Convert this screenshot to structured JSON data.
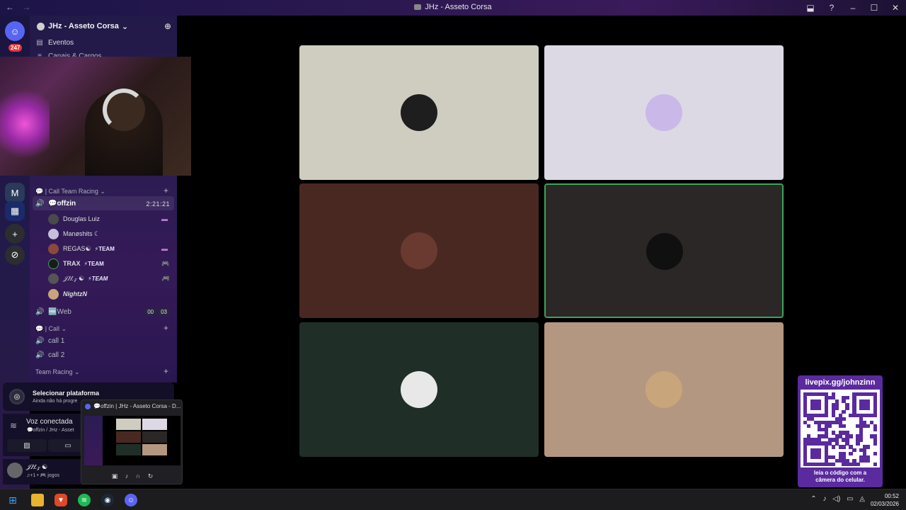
{
  "window": {
    "title": "JHz - Asseto Corsa",
    "nav_back": "←",
    "nav_forward": "→",
    "controls": [
      "⬓",
      "?",
      "–",
      "☐",
      "✕"
    ]
  },
  "servers": {
    "home_badge": "247"
  },
  "guild": {
    "name": "JHz - Asseto Corsa",
    "chevron": "⌄",
    "add_icon": "⊕"
  },
  "channels": {
    "events": "Eventos",
    "channels_roles": "Canais & Cargos",
    "category_call_team": "💬 | Call Team Racing ⌄",
    "active_channel": "💬offzin",
    "active_timer": "2:21:21",
    "members": [
      {
        "name": "Douglas Luiz",
        "team": "",
        "status": "▬"
      },
      {
        "name": "Manøshits ☾",
        "team": "",
        "status": ""
      },
      {
        "name": "REGAS☯",
        "team": "⚡TEAM",
        "status": "▬"
      },
      {
        "name": "TRAX",
        "team": "⚡TEAM",
        "status": "🎮"
      },
      {
        "name": "𝒥𝐻.𝓏 ☯",
        "team": "⚡TEAM",
        "status": "🎮"
      },
      {
        "name": "NightzN",
        "team": "",
        "status": ""
      }
    ],
    "web_channel": "🆓Web",
    "web_count_a": "00",
    "web_count_b": "03",
    "category_call": "💬 | Call ⌄",
    "call_1": "call 1",
    "call_2": "call 2",
    "category_team_racing": "Team Racing ⌄"
  },
  "platform": {
    "title": "Selecionar plataforma",
    "subtitle": "Ainda não há progre"
  },
  "voice": {
    "status": "Voz conectada",
    "channel": "💬offzin / JHz - Asset"
  },
  "user": {
    "name": "𝒥𝐻.𝓏 ☯",
    "status": "♫+1 • 🎮 jogos"
  },
  "preview": {
    "title": "💬offzin | JHz - Asseto Corsa - D..."
  },
  "tiles": [
    {
      "bg": "#cfcdc0",
      "avatar": "#1e1e1e",
      "speaking": false
    },
    {
      "bg": "#dcd9e4",
      "avatar": "#c9b8e8",
      "speaking": false
    },
    {
      "bg": "#4a2822",
      "avatar": "#6a3a30",
      "speaking": false
    },
    {
      "bg": "#2b2726",
      "avatar": "#101010",
      "speaking": true
    },
    {
      "bg": "#1f2f28",
      "avatar": "#e8e8e8",
      "speaking": false
    },
    {
      "bg": "#b49781",
      "avatar": "#c9a57c",
      "speaking": false
    }
  ],
  "pix": {
    "url": "livepix.gg/johnzinn",
    "caption_1": "leia o código com a",
    "caption_2": "câmera do celular."
  },
  "taskbar": {
    "time": "00:52",
    "date": "02/03/2026"
  },
  "colors": {
    "accent": "#5865f2",
    "speaking": "#3ba55d",
    "pix": "#5a2a9e"
  }
}
